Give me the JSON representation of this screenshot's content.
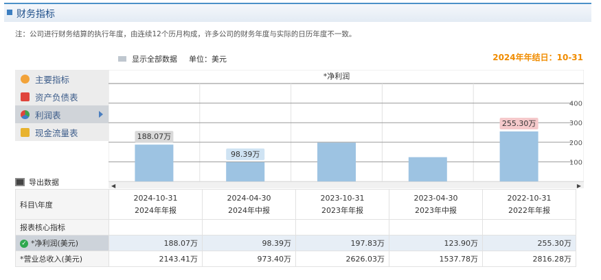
{
  "header": {
    "title": "财务指标"
  },
  "note": "注：公司进行财务结算的执行年度，由连续12个历月构成，许多公司的财务年度与实际的日历年度不一致。",
  "toolbar": {
    "show_all": "显示全部数据",
    "unit": "单位：美元",
    "year_end": "2024年年结日：10-31"
  },
  "menu": {
    "items": [
      {
        "label": "主要指标",
        "icon": "gear-icon"
      },
      {
        "label": "资产负债表",
        "icon": "document-icon"
      },
      {
        "label": "利润表",
        "icon": "pie-chart-icon"
      },
      {
        "label": "现金流量表",
        "icon": "money-icon"
      }
    ]
  },
  "export_label": "导出数据",
  "colors": {
    "bar": "#9dc3e2",
    "bar_dark_label": "#d9d9d9",
    "label_blue": "#cfe3f3",
    "label_red": "#f5c9cb",
    "accent": "#f08c00"
  },
  "chart_data": {
    "type": "bar",
    "title": "*净利润",
    "categories": [
      "2024-10-31 2024年年报",
      "2024-04-30 2024年中报",
      "2023-10-31 2023年年报",
      "2023-04-30 2023年中报",
      "2022-10-31 2022年年报"
    ],
    "values": [
      188.07,
      98.39,
      197.83,
      123.9,
      255.3
    ],
    "ylim": [
      0,
      500
    ],
    "yticks": [
      "100",
      "200",
      "300",
      "400"
    ],
    "ytick_values": [
      100,
      200,
      300,
      400
    ],
    "data_labels": [
      "188.07万",
      "98.39万",
      "",
      "",
      "255.30万"
    ],
    "grid": true
  },
  "table": {
    "header_label": "科目\\年度",
    "periods": [
      {
        "date": "2024-10-31",
        "type": "2024年年报"
      },
      {
        "date": "2024-04-30",
        "type": "2024年中报"
      },
      {
        "date": "2023-10-31",
        "type": "2023年年报"
      },
      {
        "date": "2023-04-30",
        "type": "2023年中报"
      },
      {
        "date": "2022-10-31",
        "type": "2022年年报"
      }
    ],
    "section_label": "报表核心指标",
    "rows": [
      {
        "label": "*净利润(美元)",
        "values": [
          "188.07万",
          "98.39万",
          "197.83万",
          "123.90万",
          "255.30万"
        ]
      },
      {
        "label": "*营业总收入(美元)",
        "values": [
          "2143.41万",
          "973.40万",
          "2626.03万",
          "1537.78万",
          "2816.28万"
        ]
      }
    ]
  }
}
